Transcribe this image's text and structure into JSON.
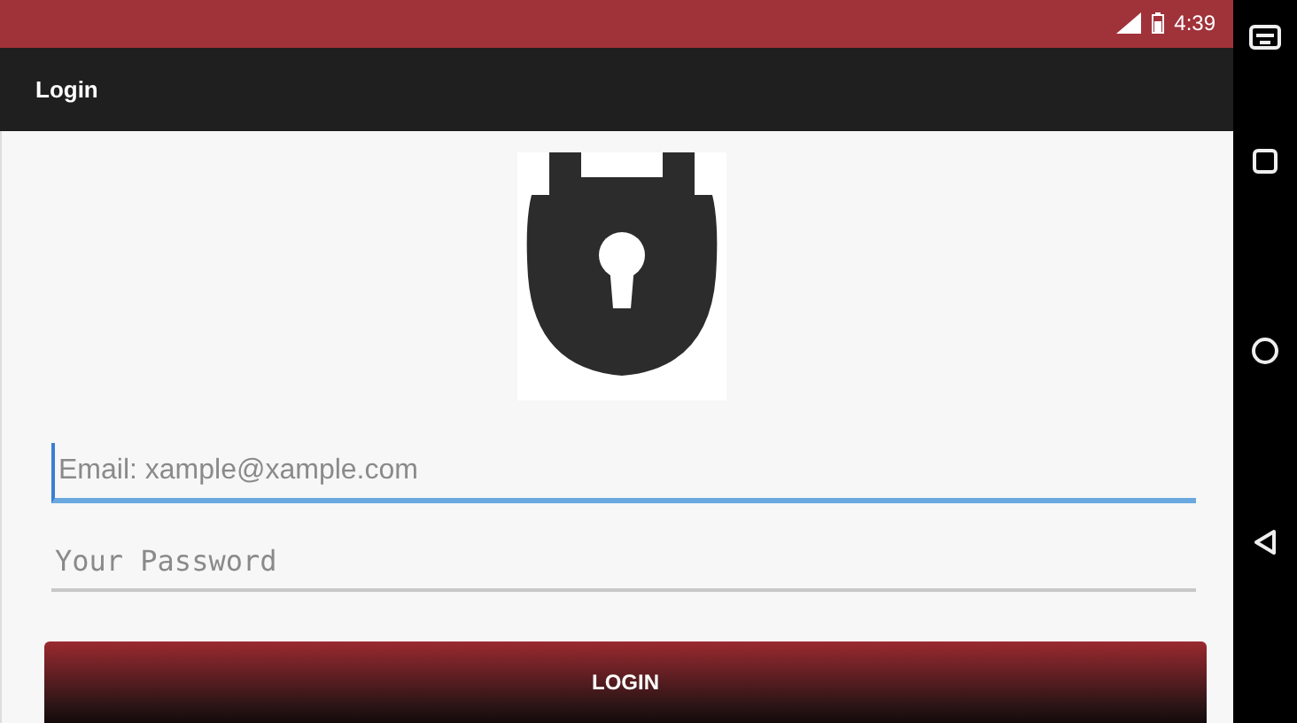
{
  "status_bar": {
    "time": "4:39"
  },
  "app_bar": {
    "title": "Login"
  },
  "fields": [
    {
      "kind": "email",
      "placeholder": "Email: xample@xample.com",
      "focused": true
    },
    {
      "kind": "password",
      "placeholder": "Your Password",
      "focused": false
    }
  ],
  "button": {
    "label": "LOGIN"
  }
}
